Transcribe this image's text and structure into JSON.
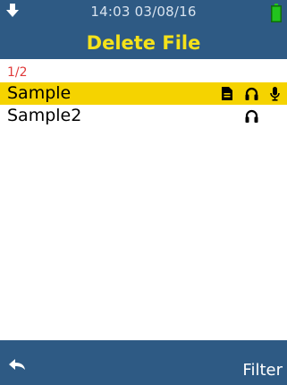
{
  "status": {
    "time": "14:03",
    "date": "03/08/16",
    "time_date": "14:03   03/08/16"
  },
  "header": {
    "title": "Delete File"
  },
  "list": {
    "page_counter": "1/2",
    "items": [
      {
        "name": "Sample",
        "selected": true,
        "icons": [
          "document-icon",
          "headphones-icon",
          "microphone-icon"
        ]
      },
      {
        "name": "Sample2",
        "selected": false,
        "icons": [
          "headphones-icon"
        ]
      }
    ]
  },
  "footer": {
    "back_icon": "back-arrow-icon",
    "filter_label": "Filter"
  },
  "colors": {
    "bar": "#2e5a84",
    "title": "#f5e21a",
    "selection": "#f5d300",
    "counter": "#e03a3a",
    "battery": "#22c41e"
  }
}
